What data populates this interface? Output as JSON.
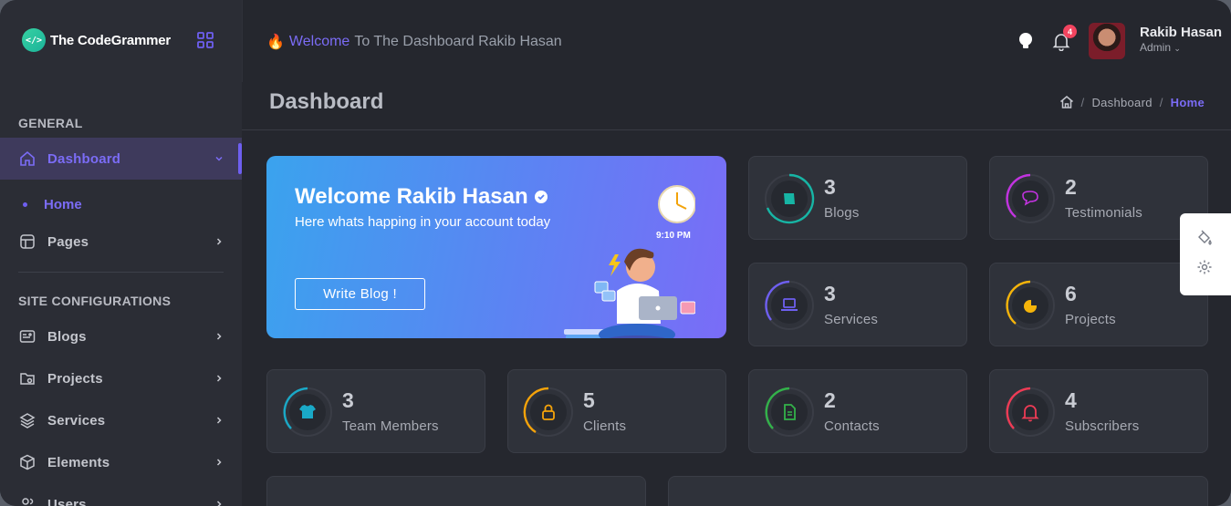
{
  "brand": {
    "name": "The CodeGrammer",
    "logo_glyph": "</>"
  },
  "sidebar": {
    "section_general": "GENERAL",
    "section_site": "SITE CONFIGURATIONS",
    "items": [
      {
        "label": "Dashboard",
        "icon": "home-icon",
        "active": true
      },
      {
        "label": "Home",
        "sub": true
      },
      {
        "label": "Pages",
        "icon": "pages-icon"
      },
      {
        "label": "Blogs",
        "icon": "blog-icon"
      },
      {
        "label": "Projects",
        "icon": "folder-icon"
      },
      {
        "label": "Services",
        "icon": "layers-icon"
      },
      {
        "label": "Elements",
        "icon": "cube-icon"
      },
      {
        "label": "Users",
        "icon": "users-icon"
      }
    ]
  },
  "header": {
    "welcome_highlight": "Welcome",
    "welcome_rest": "To The Dashboard Rakib Hasan",
    "notification_count": "4",
    "user_name": "Rakib Hasan",
    "user_role": "Admin"
  },
  "page": {
    "title": "Dashboard",
    "breadcrumb": [
      "Dashboard",
      "Home"
    ]
  },
  "hero": {
    "title": "Welcome Rakib Hasan",
    "subtitle": "Here whats happing in your account today",
    "button": "Write Blog !",
    "clock_time": "9:10 PM"
  },
  "stats": [
    {
      "value": "3",
      "label": "Blogs",
      "color": "#17b5a5"
    },
    {
      "value": "2",
      "label": "Testimonials",
      "color": "#c233e0"
    },
    {
      "value": "3",
      "label": "Services",
      "color": "#6e5ff0"
    },
    {
      "value": "6",
      "label": "Projects",
      "color": "#f5b40a"
    },
    {
      "value": "3",
      "label": "Team Members",
      "color": "#1aa9c7"
    },
    {
      "value": "5",
      "label": "Clients",
      "color": "#f5a30a"
    },
    {
      "value": "2",
      "label": "Contacts",
      "color": "#33b24a"
    },
    {
      "value": "4",
      "label": "Subscribers",
      "color": "#ee3b55"
    }
  ],
  "colors": {
    "accent": "#6e5ff0",
    "background": "#25272e",
    "sidebar": "#2b2d35",
    "card": "#2f323a"
  }
}
